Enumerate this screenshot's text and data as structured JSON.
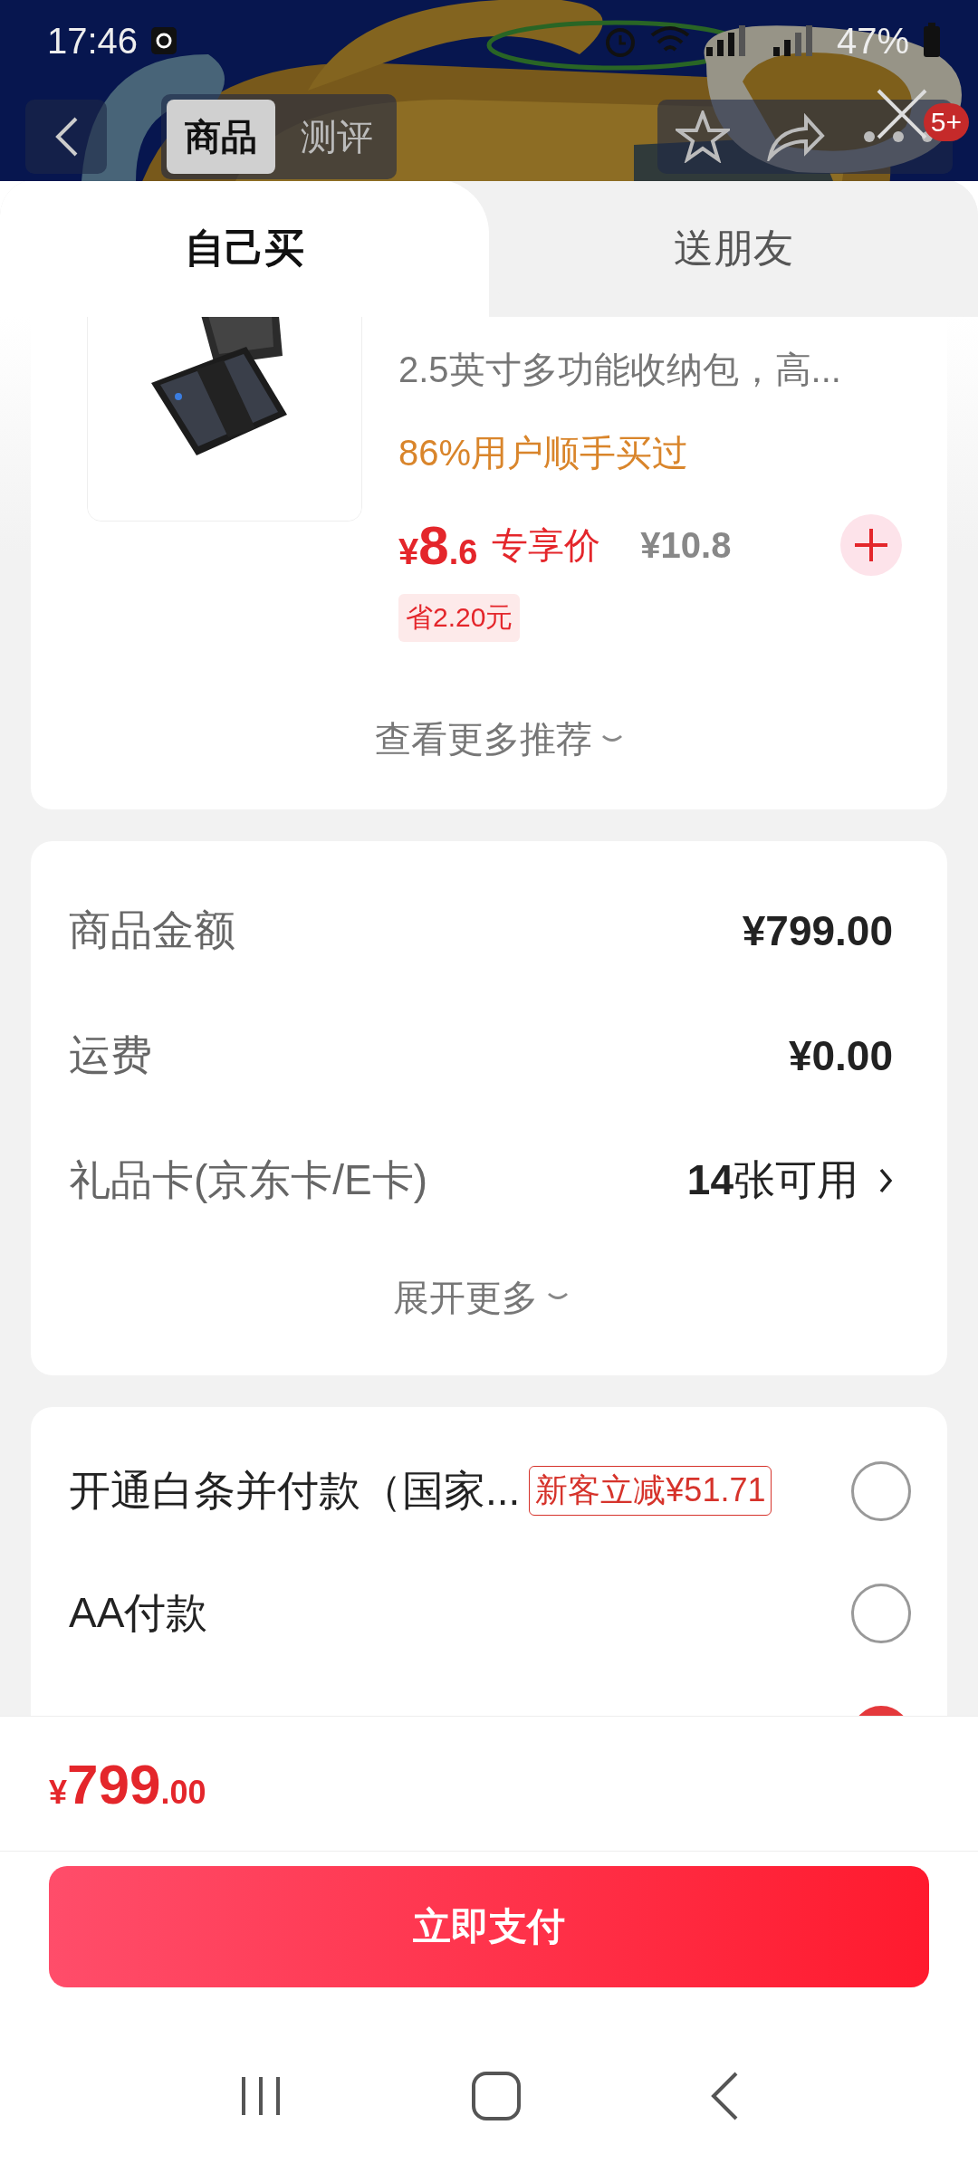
{
  "status_bar": {
    "time": "17:46",
    "battery": "47%"
  },
  "nav": {
    "tabs": [
      {
        "label": "商品",
        "selected": true
      },
      {
        "label": "测评",
        "selected": false
      }
    ],
    "badge": "5+"
  },
  "purchase_tabs": [
    {
      "label": "自己买",
      "selected": true
    },
    {
      "label": "送朋友",
      "selected": false
    }
  ],
  "recommendation": {
    "title": "2.5英寸多功能收纳包，高...",
    "social_proof": "86%用户顺手买过",
    "currency": "¥",
    "price_integer": "8",
    "price_decimal": ".6",
    "price_label": "专享价",
    "original_price": "¥10.8",
    "saving": "省2.20元",
    "more": "查看更多推荐"
  },
  "summary": {
    "rows": [
      {
        "label": "商品金额",
        "value": "¥799.00",
        "kind": "plain"
      },
      {
        "label": "运费",
        "value": "¥0.00",
        "kind": "plain"
      },
      {
        "label": "礼品卡(京东卡/E卡)",
        "value": "**14**张可用",
        "kind": "link"
      }
    ],
    "expand": "展开更多"
  },
  "payment_options": [
    {
      "label": "开通白条并付款（国家...",
      "tag": "新客立减¥51.71",
      "selected": false
    },
    {
      "label": "AA付款",
      "selected": false
    },
    {
      "selected": true
    }
  ],
  "total": {
    "currency": "¥",
    "integer": "799",
    "decimal": ".00"
  },
  "pay_button": "立即支付"
}
